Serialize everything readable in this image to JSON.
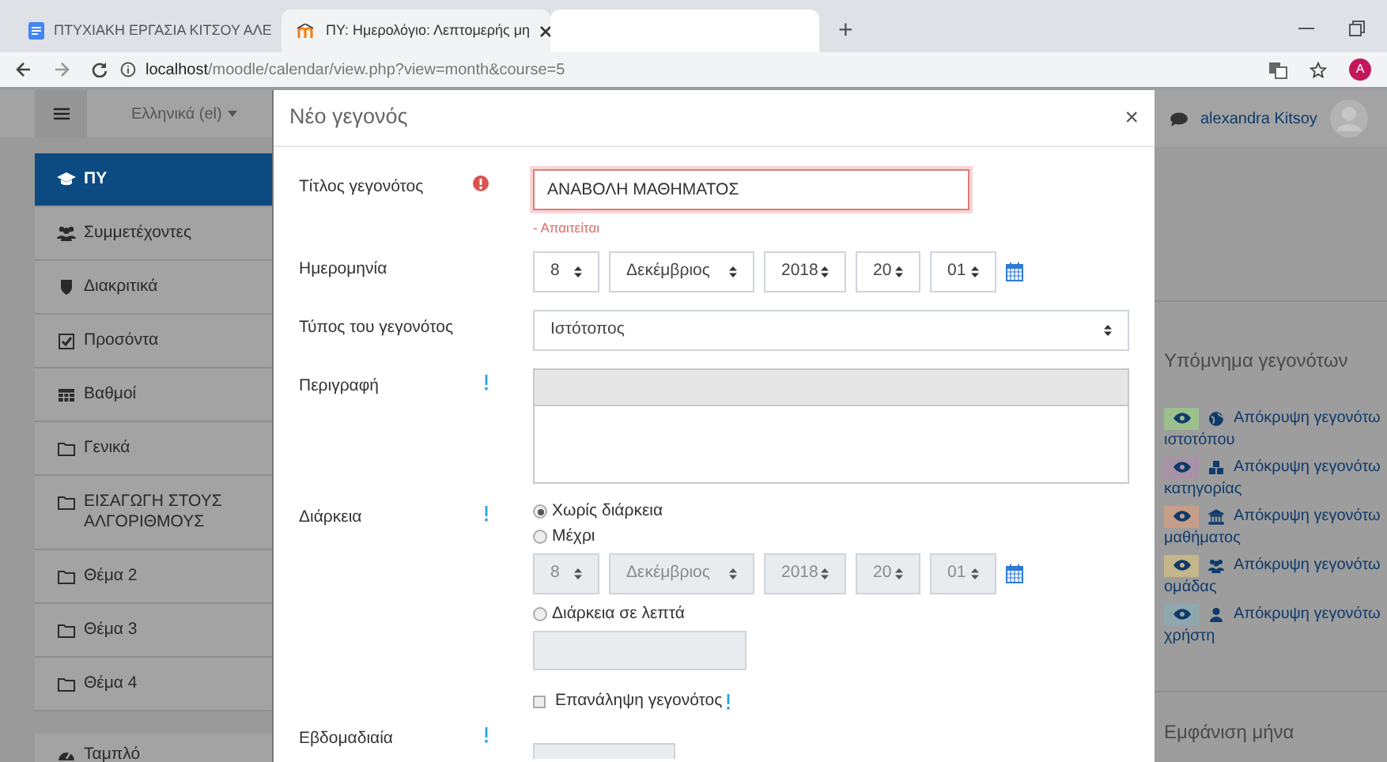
{
  "browser": {
    "tabs": [
      {
        "kind": "page",
        "title": "ΠΤΥΧΙΑΚΗ ΕΡΓΑΣΙΑ ΚΙΤΣΟΥ ΑΛΕ",
        "selected": false
      },
      {
        "kind": "page",
        "title": "ΠΥ: Ημερολόγιο: Λεπτομερής μη",
        "selected": true
      },
      {
        "kind": "blank",
        "selected": false
      }
    ],
    "new_tab": "+",
    "url": "localhost/moodle/calendar/view.php?view=month&course=5",
    "profile": "A"
  },
  "header": {
    "language": "Ελληνικά (el)"
  },
  "sidebar": {
    "items": [
      {
        "label": "ΠΥ",
        "selected": true
      },
      {
        "label": "Συμμετέχοντες",
        "selected": false
      },
      {
        "label": "Διακριτικά",
        "selected": false
      },
      {
        "label": "Προσόντα",
        "selected": false
      },
      {
        "label": "Βαθμοί",
        "selected": false
      },
      {
        "label": "Γενικά",
        "selected": false
      },
      {
        "label": "ΕΙΣΑΓΩΓΗ ΣΤΟΥΣ ΑΛΓΟΡΙΘΜΟΥΣ",
        "selected": false
      },
      {
        "label": "Θέμα 2",
        "selected": false
      },
      {
        "label": "Θέμα 3",
        "selected": false
      },
      {
        "label": "Θέμα 4",
        "selected": false
      }
    ],
    "extra_item": "Ταμπλό"
  },
  "modal": {
    "title": "Νέο γεγονός",
    "close": "×",
    "name": {
      "label": "Τίτλος γεγονότος",
      "value": "ΑΝΑΒΟΛΗ ΜΑΘΗΜΑΤΟΣ",
      "error": "- Απαιτείται"
    },
    "date": {
      "label": "Ημερομηνία",
      "parts": [
        "8",
        "Δεκέμβριος",
        "2018",
        "20",
        "01"
      ],
      "disabled": false
    },
    "type": {
      "label": "Τύπος του γεγονότος",
      "value": "Ιστότοπος"
    },
    "description": {
      "label": "Περιγραφή"
    },
    "duration": {
      "label": "Διάρκεια",
      "options": [
        {
          "label": "Χωρίς διάρκεια",
          "selected": true
        },
        {
          "label": "Μέχρι",
          "selected": false
        }
      ],
      "until": {
        "parts": [
          "8",
          "Δεκέμβριος",
          "2018",
          "20",
          "01"
        ],
        "disabled": true
      },
      "minutes_option": {
        "label": "Διάρκεια σε λεπτά",
        "selected": false
      },
      "minutes_field": {
        "disabled": true
      }
    },
    "repeat": {
      "label": "Επανάληψη γεγονότος",
      "checked": false
    },
    "weekly": {
      "label": "Εβδομαδιαία"
    }
  },
  "right": {
    "user": "alexandra Kitsoy",
    "legend_title": "Υπόμνημα γεγονότων",
    "legend": [
      {
        "lines": [
          "Απόκρυψη γεγονότω",
          "ιστοτόπου"
        ],
        "color": "#9cbf8e"
      },
      {
        "lines": [
          "Απόκρυψη γεγονότω",
          "κατηγορίας"
        ],
        "color": "#a893a6"
      },
      {
        "lines": [
          "Απόκρυψη γεγονότω",
          "μαθήματος"
        ],
        "color": "#c69e8a"
      },
      {
        "lines": [
          "Απόκρυψη γεγονότω",
          "ομάδας"
        ],
        "color": "#c5b68a"
      },
      {
        "lines": [
          "Απόκρυψη γεγονότω",
          "χρήστη"
        ],
        "color": "#8fa7ae"
      }
    ],
    "month_title": "Εμφάνιση μήνα"
  }
}
